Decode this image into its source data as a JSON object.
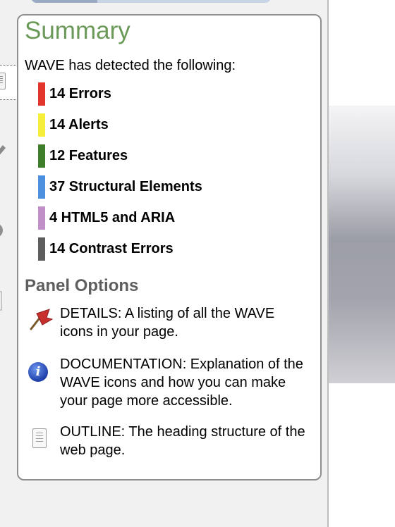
{
  "summary": {
    "title": "Summary",
    "intro": "WAVE has detected the following:",
    "counts": [
      {
        "label": "14 Errors",
        "color": "#e2352b"
      },
      {
        "label": "14 Alerts",
        "color": "#f5ef3b"
      },
      {
        "label": "12 Features",
        "color": "#3e7d2a"
      },
      {
        "label": "37 Structural Elements",
        "color": "#4b8fde"
      },
      {
        "label": "4 HTML5 and ARIA",
        "color": "#c08fc8"
      },
      {
        "label": "14 Contrast Errors",
        "color": "#5d5d5d"
      }
    ]
  },
  "panel_options": {
    "title": "Panel Options",
    "items": [
      {
        "icon": "flag-icon",
        "text": "DETAILS: A listing of all the WAVE icons in your page."
      },
      {
        "icon": "info-icon",
        "text": "DOCUMENTATION: Explanation of the WAVE icons and how you can make your page more accessible."
      },
      {
        "icon": "outline-icon",
        "text": "OUTLINE: The heading structure of the web page."
      }
    ]
  }
}
